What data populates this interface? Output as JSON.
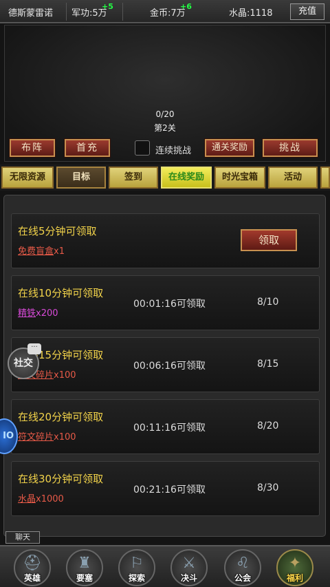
{
  "topbar": {
    "player_name": "德斯蒙雷诺",
    "merit_label": "军功:",
    "merit_value": "5万",
    "merit_plus": "+5",
    "gold_label": "金币:",
    "gold_value": "7万",
    "gold_plus": "+6",
    "crystal_label": "水晶:",
    "crystal_value": "1118",
    "recharge_label": "充值"
  },
  "battle": {
    "progress": "0/20",
    "stage": "第2关",
    "formation_label": "布阵",
    "first_recharge_label": "首充",
    "continuous_label": "连续挑战",
    "clear_reward_label": "通关奖励",
    "challenge_label": "挑战"
  },
  "tabs": [
    {
      "label": "无限资源"
    },
    {
      "label": "目标"
    },
    {
      "label": "签到"
    },
    {
      "label": "在线奖励"
    },
    {
      "label": "时光宝箱"
    },
    {
      "label": "活动"
    }
  ],
  "rewards": [
    {
      "title": "在线5分钟可领取",
      "item": "免费盲盒",
      "qty": "x1",
      "claim_label": "领取",
      "item_color": "#e85a48"
    },
    {
      "title": "在线10分钟可领取",
      "item": "精铁",
      "qty": "x200",
      "timer": "00:01:16可领取",
      "count": "8/10",
      "item_color": "#d84ad8"
    },
    {
      "title": "在线15分钟可领取",
      "item": "符文碎片",
      "qty": "x100",
      "timer": "00:06:16可领取",
      "count": "8/15",
      "item_color": "#e85a48"
    },
    {
      "title": "在线20分钟可领取",
      "item": "符文碎片",
      "qty": "x100",
      "timer": "00:11:16可领取",
      "count": "8/20",
      "item_color": "#e85a48"
    },
    {
      "title": "在线30分钟可领取",
      "item": "水晶",
      "qty": "x1000",
      "timer": "00:21:16可领取",
      "count": "8/30",
      "item_color": "#e85a48"
    }
  ],
  "floating": {
    "social_label": "社交",
    "io_label": "IO"
  },
  "chat_label": "聊天",
  "nav": [
    {
      "label": "英雄",
      "icon": "helmet-icon"
    },
    {
      "label": "要塞",
      "icon": "fortress-icon"
    },
    {
      "label": "探索",
      "icon": "map-icon"
    },
    {
      "label": "决斗",
      "icon": "crossed-swords-icon"
    },
    {
      "label": "公会",
      "icon": "lion-icon"
    },
    {
      "label": "福利",
      "icon": "gift-icon"
    }
  ]
}
